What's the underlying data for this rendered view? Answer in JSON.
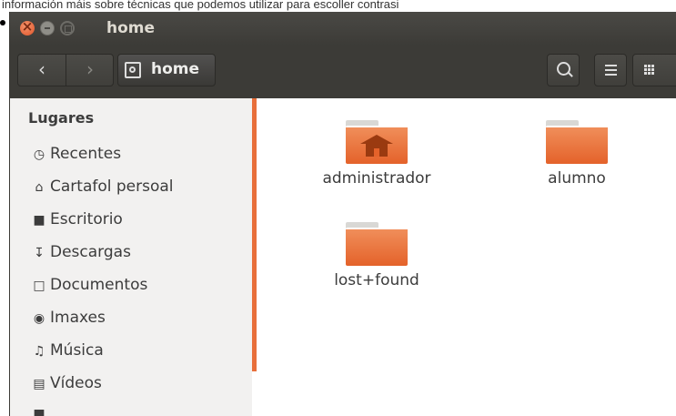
{
  "page_caption": "información máis sobre técnicas que podemos utilizar para escoller contrasi",
  "window": {
    "title": "home"
  },
  "toolbar": {
    "path_label": "home"
  },
  "sidebar": {
    "heading": "Lugares",
    "items": [
      {
        "label": "Recentes",
        "icon": "clock-icon"
      },
      {
        "label": "Cartafol persoal",
        "icon": "home-icon"
      },
      {
        "label": "Escritorio",
        "icon": "desktop-folder-icon"
      },
      {
        "label": "Descargas",
        "icon": "download-icon"
      },
      {
        "label": "Documentos",
        "icon": "document-icon"
      },
      {
        "label": "Imaxes",
        "icon": "camera-icon"
      },
      {
        "label": "Música",
        "icon": "music-icon"
      },
      {
        "label": "Vídeos",
        "icon": "film-icon"
      }
    ]
  },
  "files": [
    {
      "name": "administrador",
      "icon": "home-folder-icon"
    },
    {
      "name": "alumno",
      "icon": "folder-icon"
    },
    {
      "name": "lost+found",
      "icon": "folder-icon"
    }
  ],
  "colors": {
    "accent": "#e86f3b",
    "titlebar": "#3c3b37",
    "sidebar_bg": "#f2f1f0"
  }
}
